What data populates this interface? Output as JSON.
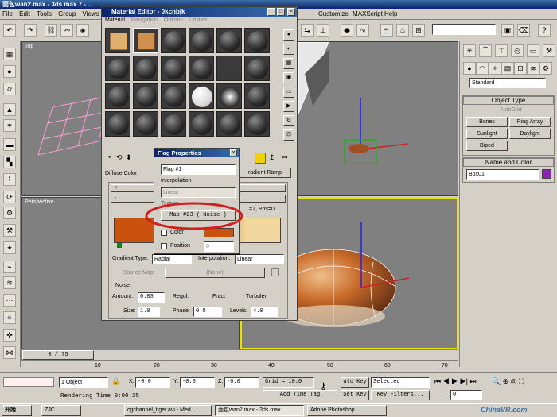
{
  "app_title": "面包wan2.max - 3ds max 7 - ...",
  "menu": [
    "File",
    "Edit",
    "Tools",
    "Group",
    "Views",
    "G",
    "Customize",
    "MAXScript",
    "Help"
  ],
  "viewports": {
    "top": "Top",
    "perspective": "Perspective"
  },
  "material_editor": {
    "title": "Material Editor - 0kcnbjk",
    "menu": [
      "Material",
      "Navigation",
      "Options",
      "Utilities"
    ],
    "diffuse_label": "Diffuse Color:",
    "gradient_ramp_btn": "radient Ramp",
    "plus": "+",
    "minus": "-",
    "pos_text": "=7, Pos=0",
    "gradient_type_label": "Gradient Type:",
    "gradient_type_value": "Radial",
    "interpolation_label": "Interpolation:",
    "interpolation_value": "Linear",
    "source_map_label": "Source Map:",
    "source_map_value": "(None)",
    "noise_label": "Noise:",
    "amount_label": "Amount:",
    "amount_value": "0.03",
    "regular_label": "Regul:",
    "fractal_label": "Fract",
    "turbulence_label": "Turbuler",
    "size_label": "Size:",
    "size_value": "1.0",
    "phase_label": "Phase:",
    "phase_value": "0.0",
    "levels_label": "Levels:",
    "levels_value": "4.0"
  },
  "flag_properties": {
    "title": "Flag Properties",
    "flag_value": "Flag #1",
    "interpolation_label": "Interpolation",
    "interpolation_value": "Linear",
    "texture_label": "Texture",
    "texture_map": "Map #23  ( Noise )",
    "color_label": "Color",
    "position_label": "Position",
    "position_value": "0"
  },
  "command_panel": {
    "dropdown": "Standard",
    "object_type_header": "Object Type",
    "autogrid_label": "AutoGrid",
    "buttons": [
      "Bones",
      "Ring Array",
      "Sunlight",
      "Daylight",
      "Biped"
    ],
    "name_color_header": "Name and Color",
    "object_name": "Box01",
    "object_color": "#8b22b5"
  },
  "timeline": {
    "frame_counter": "0 / 75",
    "ticks": [
      "0",
      "10",
      "20",
      "30",
      "40",
      "50",
      "60",
      "70"
    ]
  },
  "status": {
    "selection": "1 Object",
    "x_label": "X:",
    "x_value": "-0.0",
    "y_label": "Y:",
    "y_value": "-0.0",
    "z_label": "Z:",
    "z_value": "-0.0",
    "grid": "Grid = 10.0",
    "auto_key": "uto Key",
    "selected": "Selected",
    "set_key": "Set Key",
    "key_filters": "Key Filters...",
    "frame": "0",
    "rendering_time": "Rendering Time  0:00:25",
    "add_time_tag": "Add Time Tag"
  },
  "taskbar": {
    "start": "开始",
    "items": [
      "ZJC",
      "cgchannel_tiger.avi - Med...",
      "面包wan2.max - 3ds max...",
      "Adobe Photoshop"
    ],
    "watermark": "ChinaVR.com"
  },
  "colors": {
    "annotation_red": "#d02020",
    "gradient_orange": "#c8520e",
    "gradient_light": "#f2d8a0",
    "viewport_active": "#f0e000"
  }
}
